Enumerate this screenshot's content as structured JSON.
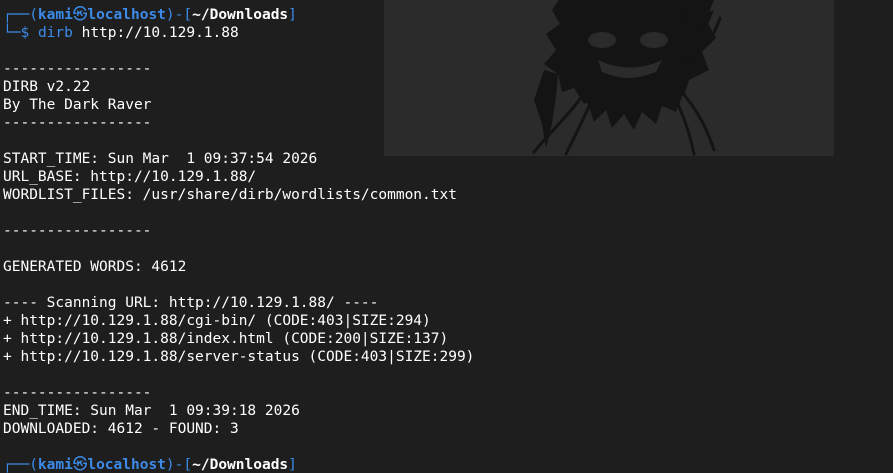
{
  "colors": {
    "background": "#1e1e1e",
    "prompt_accent": "#3c8be8",
    "text": "#ffffff",
    "art_panel": "#2b2b2b"
  },
  "prompt": {
    "corner_top": "┌──(",
    "user": "kami",
    "skull_symbol": "㉿",
    "host": "localhost",
    "sep": ")-[",
    "cwd": "~/Downloads",
    "close": "]",
    "corner_bottom": "└─",
    "dollar": "$ "
  },
  "command": {
    "name": "dirb",
    "arg": " http://10.129.1.88"
  },
  "output": {
    "sep1": "-----------------",
    "version": "DIRB v2.22",
    "author": "By The Dark Raver",
    "sep2": "-----------------",
    "start_time": "START_TIME: Sun Mar  1 09:37:54 2026",
    "url_base": "URL_BASE: http://10.129.1.88/",
    "wordlist": "WORDLIST_FILES: /usr/share/dirb/wordlists/common.txt",
    "sep3": "-----------------",
    "generated": "GENERATED WORDS: 4612",
    "scanning": "---- Scanning URL: http://10.129.1.88/ ----",
    "results": [
      "+ http://10.129.1.88/cgi-bin/ (CODE:403|SIZE:294)",
      "+ http://10.129.1.88/index.html (CODE:200|SIZE:137)",
      "+ http://10.129.1.88/server-status (CODE:403|SIZE:299)"
    ],
    "sep4": "-----------------",
    "end_time": "END_TIME: Sun Mar  1 09:39:18 2026",
    "downloaded": "DOWNLOADED: 4612 - FOUND: 3"
  },
  "icons": {
    "background_art": "kali-dragon-art"
  }
}
